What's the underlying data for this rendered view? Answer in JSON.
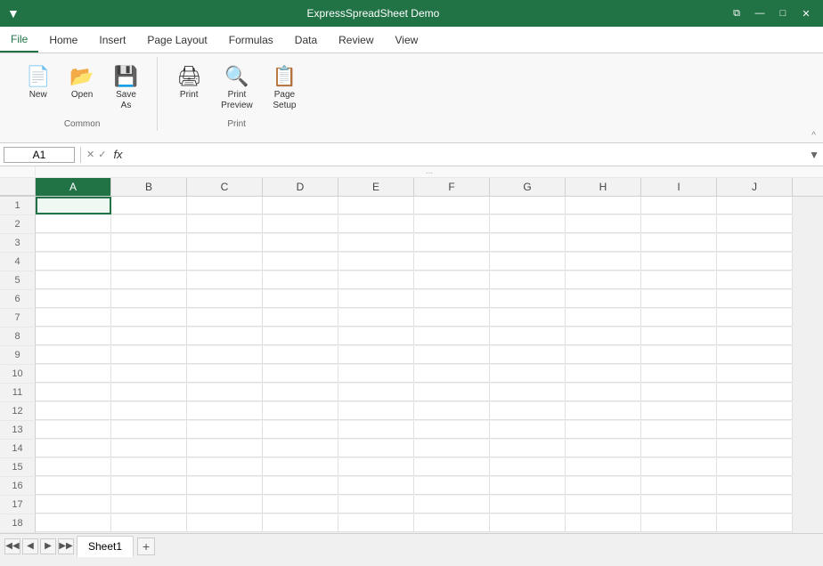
{
  "titleBar": {
    "title": "ExpressSpreadSheet Demo",
    "icon": "▼",
    "controls": {
      "restore": "⧉",
      "minimize": "—",
      "maximize": "□",
      "close": "✕"
    }
  },
  "menuBar": {
    "items": [
      {
        "label": "File",
        "active": true
      },
      {
        "label": "Home"
      },
      {
        "label": "Insert"
      },
      {
        "label": "Page Layout"
      },
      {
        "label": "Formulas"
      },
      {
        "label": "Data"
      },
      {
        "label": "Review"
      },
      {
        "label": "View"
      }
    ]
  },
  "ribbon": {
    "groups": [
      {
        "label": "Common",
        "buttons": [
          {
            "id": "new",
            "icon": "📄",
            "label": "New"
          },
          {
            "id": "open",
            "icon": "📂",
            "label": "Open"
          },
          {
            "id": "save-as",
            "icon": "💾",
            "label": "Save\nAs"
          }
        ]
      },
      {
        "label": "Print",
        "buttons": [
          {
            "id": "print",
            "icon": "🖨",
            "label": "Print"
          },
          {
            "id": "print-preview",
            "icon": "🔍",
            "label": "Print\nPreview"
          },
          {
            "id": "page-setup",
            "icon": "📋",
            "label": "Page\nSetup"
          }
        ]
      }
    ],
    "collapseIcon": "^"
  },
  "formulaBar": {
    "nameBox": "A1",
    "cancelIcon": "✕",
    "confirmIcon": "✓",
    "fxLabel": "fx",
    "value": "",
    "expandIcon": "▼"
  },
  "grid": {
    "columns": [
      "A",
      "B",
      "C",
      "D",
      "E",
      "F",
      "G",
      "H",
      "I",
      "J"
    ],
    "rows": [
      1,
      2,
      3,
      4,
      5,
      6,
      7,
      8,
      9,
      10,
      11,
      12,
      13,
      14,
      15,
      16,
      17,
      18
    ],
    "selectedCell": "A1",
    "selectedCol": "A",
    "selectedRow": 1
  },
  "sheetTabs": {
    "navButtons": [
      "◀◀",
      "◀",
      "▶",
      "▶▶"
    ],
    "sheets": [
      {
        "label": "Sheet1",
        "active": true
      }
    ],
    "addButtonLabel": "+"
  }
}
